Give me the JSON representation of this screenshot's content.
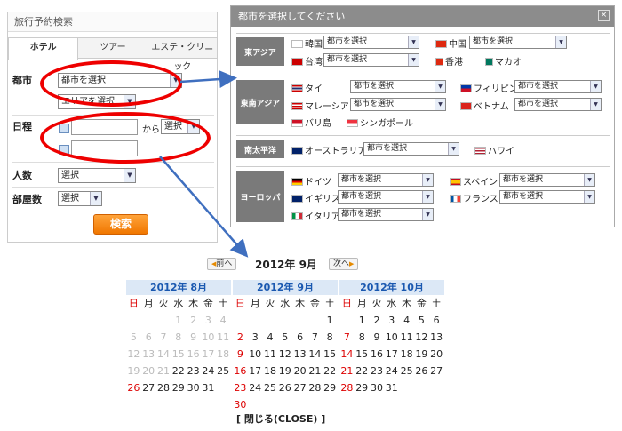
{
  "panel": {
    "title": "旅行予約検索",
    "tabs": [
      "ホテル",
      "ツアー",
      "エステ・クリニック"
    ],
    "city_label": "都市",
    "city_value": "都市を選択",
    "area_value": "エリアを選択",
    "date_label": "日程",
    "kara": "から",
    "date_select": "選択",
    "people_label": "人数",
    "people_value": "選択",
    "rooms_label": "部屋数",
    "rooms_value": "選択",
    "search_button": "検索"
  },
  "dialog": {
    "title": "都市を選択してください",
    "close": "×",
    "select_placeholder": "都市を選択",
    "regions": [
      {
        "name": "東アジア",
        "cities": [
          "韓国",
          "中国",
          "台湾",
          "香港",
          "マカオ"
        ]
      },
      {
        "name": "東南アジア",
        "cities": [
          "タイ",
          "フィリピン",
          "マレーシア",
          "ベトナム",
          "バリ島",
          "シンガポール"
        ]
      },
      {
        "name": "南太平洋",
        "cities": [
          "オーストラリア",
          "ハワイ"
        ]
      },
      {
        "name": "ヨーロッパ",
        "cities": [
          "ドイツ",
          "スペイン",
          "イギリス",
          "フランス",
          "イタリア"
        ]
      }
    ]
  },
  "calendar": {
    "prev": "前へ",
    "next": "次へ",
    "current": "2012年 9月",
    "weekdays": [
      "日",
      "月",
      "火",
      "水",
      "木",
      "金",
      "土"
    ],
    "months": [
      {
        "title": "2012年 8月",
        "rows": [
          [
            [
              "",
              ""
            ],
            [
              "",
              ""
            ],
            [
              "",
              ""
            ],
            [
              "1",
              "g"
            ],
            [
              "2",
              "g"
            ],
            [
              "3",
              "g"
            ],
            [
              "4",
              "g"
            ]
          ],
          [
            [
              "5",
              "g"
            ],
            [
              "6",
              "g"
            ],
            [
              "7",
              "g"
            ],
            [
              "8",
              "g"
            ],
            [
              "9",
              "g"
            ],
            [
              "10",
              "g"
            ],
            [
              "11",
              "g"
            ]
          ],
          [
            [
              "12",
              "g"
            ],
            [
              "13",
              "g"
            ],
            [
              "14",
              "g"
            ],
            [
              "15",
              "g"
            ],
            [
              "16",
              "g"
            ],
            [
              "17",
              "g"
            ],
            [
              "18",
              "g"
            ]
          ],
          [
            [
              "19",
              "g"
            ],
            [
              "20",
              "g"
            ],
            [
              "21",
              "g"
            ],
            [
              "22",
              ""
            ],
            [
              "23",
              ""
            ],
            [
              "24",
              ""
            ],
            [
              "25",
              ""
            ]
          ],
          [
            [
              "26",
              "s"
            ],
            [
              "27",
              ""
            ],
            [
              "28",
              ""
            ],
            [
              "29",
              ""
            ],
            [
              "30",
              ""
            ],
            [
              "31",
              ""
            ],
            [
              "",
              ""
            ]
          ]
        ]
      },
      {
        "title": "2012年 9月",
        "rows": [
          [
            [
              "",
              ""
            ],
            [
              "",
              ""
            ],
            [
              "",
              ""
            ],
            [
              "",
              ""
            ],
            [
              "",
              ""
            ],
            [
              "",
              ""
            ],
            [
              "1",
              ""
            ]
          ],
          [
            [
              "2",
              "s"
            ],
            [
              "3",
              ""
            ],
            [
              "4",
              ""
            ],
            [
              "5",
              ""
            ],
            [
              "6",
              ""
            ],
            [
              "7",
              ""
            ],
            [
              "8",
              ""
            ]
          ],
          [
            [
              "9",
              "s"
            ],
            [
              "10",
              ""
            ],
            [
              "11",
              ""
            ],
            [
              "12",
              ""
            ],
            [
              "13",
              ""
            ],
            [
              "14",
              ""
            ],
            [
              "15",
              ""
            ]
          ],
          [
            [
              "16",
              "s"
            ],
            [
              "17",
              ""
            ],
            [
              "18",
              ""
            ],
            [
              "19",
              ""
            ],
            [
              "20",
              ""
            ],
            [
              "21",
              ""
            ],
            [
              "22",
              ""
            ]
          ],
          [
            [
              "23",
              "s"
            ],
            [
              "24",
              ""
            ],
            [
              "25",
              ""
            ],
            [
              "26",
              ""
            ],
            [
              "27",
              ""
            ],
            [
              "28",
              ""
            ],
            [
              "29",
              ""
            ]
          ],
          [
            [
              "30",
              "s"
            ],
            [
              "",
              ""
            ],
            [
              "",
              ""
            ],
            [
              "",
              ""
            ],
            [
              "",
              ""
            ],
            [
              "",
              ""
            ],
            [
              "",
              ""
            ]
          ]
        ]
      },
      {
        "title": "2012年 10月",
        "rows": [
          [
            [
              "",
              ""
            ],
            [
              "1",
              ""
            ],
            [
              "2",
              ""
            ],
            [
              "3",
              ""
            ],
            [
              "4",
              ""
            ],
            [
              "5",
              ""
            ],
            [
              "6",
              ""
            ]
          ],
          [
            [
              "7",
              "s"
            ],
            [
              "8",
              ""
            ],
            [
              "9",
              ""
            ],
            [
              "10",
              ""
            ],
            [
              "11",
              ""
            ],
            [
              "12",
              ""
            ],
            [
              "13",
              ""
            ]
          ],
          [
            [
              "14",
              "s"
            ],
            [
              "15",
              ""
            ],
            [
              "16",
              ""
            ],
            [
              "17",
              ""
            ],
            [
              "18",
              ""
            ],
            [
              "19",
              ""
            ],
            [
              "20",
              ""
            ]
          ],
          [
            [
              "21",
              "s"
            ],
            [
              "22",
              ""
            ],
            [
              "23",
              ""
            ],
            [
              "24",
              ""
            ],
            [
              "25",
              ""
            ],
            [
              "26",
              ""
            ],
            [
              "27",
              ""
            ]
          ],
          [
            [
              "28",
              "s"
            ],
            [
              "29",
              ""
            ],
            [
              "30",
              ""
            ],
            [
              "31",
              ""
            ],
            [
              "",
              ""
            ],
            [
              "",
              ""
            ],
            [
              "",
              ""
            ]
          ]
        ]
      }
    ],
    "close_link": "[ 閉じる(CLOSE) ]"
  }
}
